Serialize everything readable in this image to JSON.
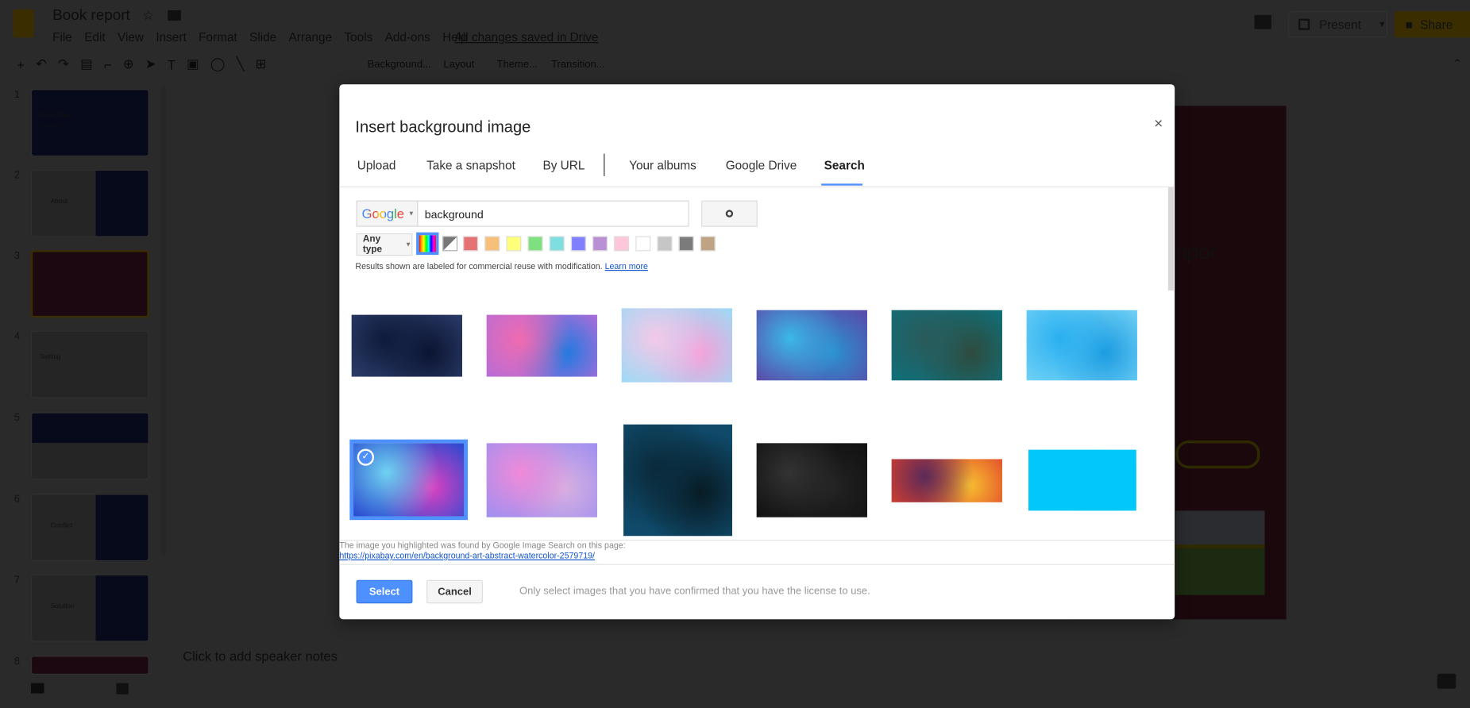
{
  "app": {
    "doc_title": "Book report",
    "save_status": "All changes saved in Drive",
    "menu": [
      "File",
      "Edit",
      "View",
      "Insert",
      "Format",
      "Slide",
      "Arrange",
      "Tools",
      "Add-ons",
      "Help"
    ],
    "toolbar": {
      "background": "Background...",
      "layout": "Layout",
      "theme": "Theme...",
      "transition": "Transition..."
    },
    "present": "Present",
    "share": "Share",
    "accent": "#f4b400"
  },
  "filmstrip": {
    "slides": [
      {
        "n": "1",
        "title": "Book Title",
        "subtitle": "A report by Your Name"
      },
      {
        "n": "2",
        "title": "About"
      },
      {
        "n": "3",
        "title": ""
      },
      {
        "n": "4",
        "title": "Setting"
      },
      {
        "n": "5",
        "title": ""
      },
      {
        "n": "6",
        "title": "Conflict"
      },
      {
        "n": "7",
        "title": "Solution"
      },
      {
        "n": "8",
        "title": ""
      }
    ]
  },
  "notes": {
    "placeholder": "Click to add speaker notes"
  },
  "slide_text": "npor",
  "dialog": {
    "title": "Insert background image",
    "close": "×",
    "tabs": [
      "Upload",
      "Take a snapshot",
      "By URL",
      "Your albums",
      "Google Drive",
      "Search"
    ],
    "active_tab": "Search",
    "search": {
      "engine": "Google",
      "query": "background"
    },
    "type_filter": "Any type",
    "swatches": [
      "#e57373",
      "#f6bf7a",
      "#ffff7a",
      "#7ee07e",
      "#7fdedf",
      "#7f7fff",
      "#b990d4",
      "#fdc6d9",
      "#ffffff",
      "#c6c6c6",
      "#7b7b7b",
      "#c0a385"
    ],
    "notice": "Results shown are labeled for commercial reuse with modification.",
    "learn_more": "Learn more",
    "images": [
      {
        "colors": [
          "#0e1a3a",
          "#2c3e6b",
          "#0a1230"
        ]
      },
      {
        "colors": [
          "#f06bb0",
          "#b46cd8",
          "#1a7be0"
        ]
      },
      {
        "colors": [
          "#f4c8e8",
          "#9fd9f5",
          "#f6a0d8"
        ]
      },
      {
        "colors": [
          "#3ab8e8",
          "#5a4aa8",
          "#2a90d0"
        ]
      },
      {
        "colors": [
          "#2a5a5a",
          "#0f6f7a",
          "#2f4a3a"
        ]
      },
      {
        "colors": [
          "#2ab0f0",
          "#6fd0f5",
          "#1a9ae0"
        ]
      },
      {
        "colors": [
          "#6fd2f0",
          "#2a4ad0",
          "#e040c0"
        ],
        "selected": true
      },
      {
        "colors": [
          "#f08ad8",
          "#a090f0",
          "#d8b0e0"
        ]
      },
      {
        "colors": [
          "#0a2a3a",
          "#0f4a6a",
          "#071820"
        ]
      },
      {
        "colors": [
          "#333333",
          "#111111",
          "#222222"
        ]
      },
      {
        "colors": [
          "#5a2a5a",
          "#e0402a",
          "#f8c030"
        ]
      },
      {
        "colors": [
          "#00c8f8",
          "#00c8f8",
          "#00c8f8"
        ]
      }
    ],
    "source_label": "The image you highlighted was found by Google Image Search on this page:",
    "source_url": "https://pixabay.com/en/background-art-abstract-watercolor-2579719/",
    "select": "Select",
    "cancel": "Cancel",
    "license_note": "Only select images that you have confirmed that you have the license to use.",
    "primary_color": "#4d90fe"
  }
}
